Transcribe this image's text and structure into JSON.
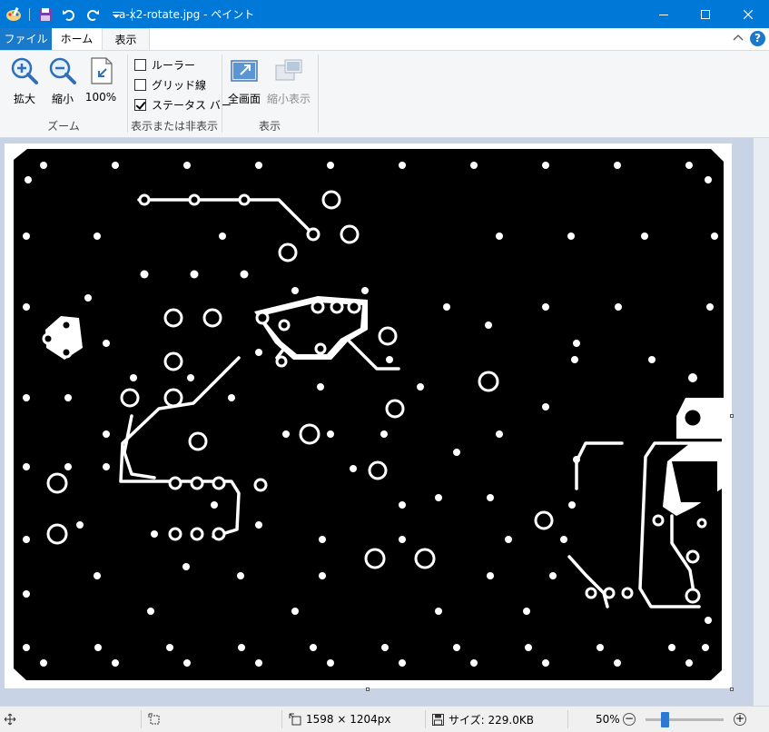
{
  "window": {
    "title": "a-x2-rotate.jpg - ペイント",
    "controls": {
      "minimize": "minimize-icon",
      "maximize": "maximize-icon",
      "close": "close-icon"
    }
  },
  "quick_access": [
    "paint-app-icon",
    "save-icon",
    "undo-icon",
    "redo-icon",
    "customize-dropdown-icon"
  ],
  "tabs": [
    {
      "label": "ファイル"
    },
    {
      "label": "ホーム"
    },
    {
      "label": "表示"
    }
  ],
  "ribbon": {
    "zoom": {
      "label": "ズーム",
      "zoom_in": "拡大",
      "zoom_out": "縮小",
      "hundred": "100%"
    },
    "show_hide": {
      "label": "表示または非表示",
      "ruler": {
        "label": "ルーラー",
        "checked": false
      },
      "gridlines": {
        "label": "グリッド線",
        "checked": false
      },
      "statusbar": {
        "label": "ステータス バー",
        "checked": true
      }
    },
    "display": {
      "label": "表示",
      "fullscreen": "全画面",
      "thumbnail": "縮小表示"
    }
  },
  "statusbar": {
    "dimensions": "1598 × 1204px",
    "size": "サイズ: 229.0KB",
    "zoom": "50%",
    "zoom_level": 0.5
  },
  "colors": {
    "titlebar": "#0078d7",
    "file_tab": "#1979ca",
    "ribbon_bg": "#f5f6f7",
    "workspace": "#c8d4e6"
  }
}
